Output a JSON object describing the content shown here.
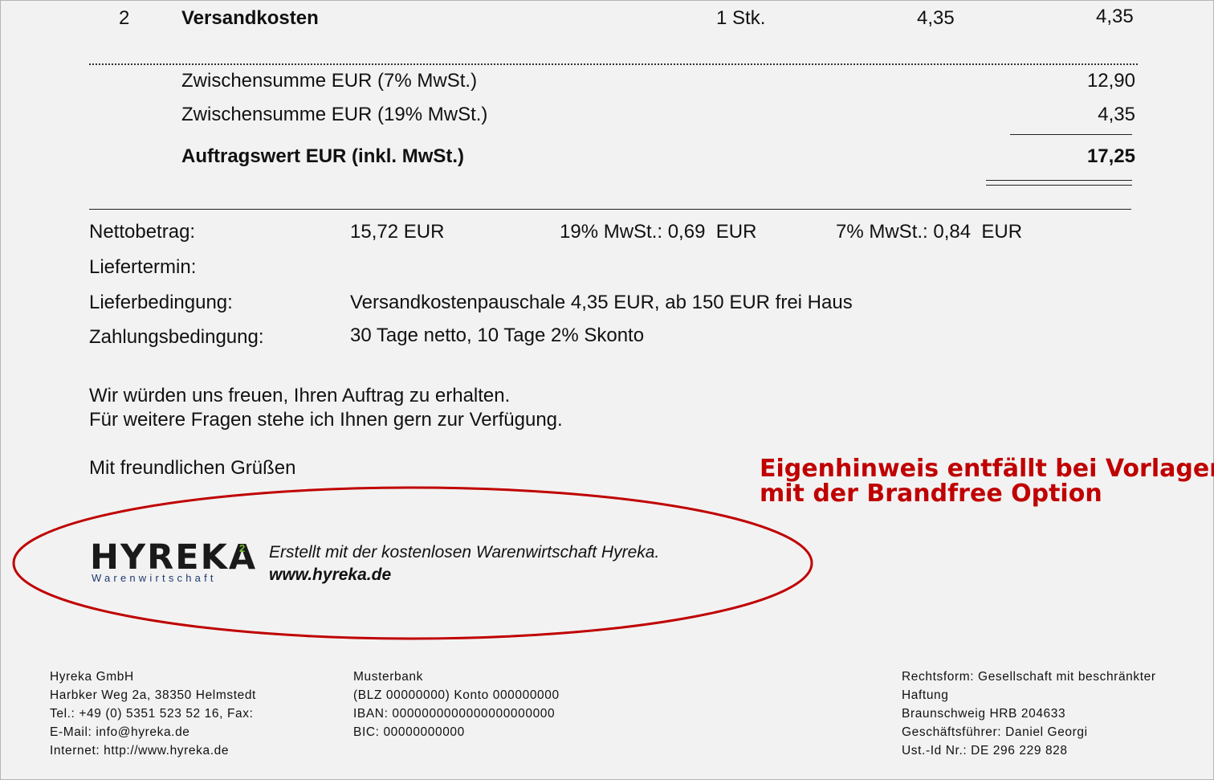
{
  "item": {
    "position": "2",
    "name": "Versandkosten",
    "quantity": "1 Stk.",
    "unit_price": "4,35",
    "total": "4,35"
  },
  "subtotals": {
    "sub7_label": "Zwischensumme EUR (7% MwSt.)",
    "sub7_value": "12,90",
    "sub19_label": "Zwischensumme EUR (19% MwSt.)",
    "sub19_value": "4,35",
    "order_label": "Auftragswert EUR (inkl. MwSt.)",
    "order_value": "17,25"
  },
  "summary": {
    "net_label": "Nettobetrag:",
    "net_value": "15,72 EUR",
    "vat19": "19% MwSt.: 0,69  EUR",
    "vat7": "7% MwSt.: 0,84  EUR",
    "delivery_date_label": "Liefertermin:",
    "delivery_terms_label": "Lieferbedingung:",
    "delivery_terms_value": "Versandkostenpauschale 4,35 EUR, ab 150 EUR frei Haus",
    "payment_terms_label": "Zahlungsbedingung:",
    "payment_terms_value": "30 Tage netto, 10 Tage 2% Skonto"
  },
  "closing": {
    "line1": "Wir würden uns freuen, Ihren Auftrag zu erhalten.",
    "line2": "Für weitere Fragen stehe ich Ihnen gern zur Verfügung.",
    "greeting": "Mit freundlichen Grüßen"
  },
  "promo": {
    "line1": "Eigenhinweis entfällt bei Vorlagen",
    "line2": "mit der Brandfree Option",
    "color": "#c00000"
  },
  "branding": {
    "logo_word": "HYREKA",
    "logo_superscript": "2",
    "logo_subtitle": "Warenwirtschaft",
    "text": "Erstellt mit der kostenlosen Warenwirtschaft Hyreka.",
    "url": "www.hyreka.de"
  },
  "footer": {
    "company": [
      "Hyreka GmbH",
      "Harbker Weg 2a, 38350 Helmstedt",
      "Tel.: +49 (0) 5351 523 52 16, Fax:",
      "E-Mail: info@hyreka.de",
      "Internet: http://www.hyreka.de"
    ],
    "bank": [
      "Musterbank",
      "(BLZ 00000000) Konto 000000000",
      "IBAN: 0000000000000000000000",
      "BIC: 00000000000"
    ],
    "legal": [
      "Rechtsform: Gesellschaft mit beschränkter",
      "Haftung",
      "Braunschweig HRB 204633",
      "Geschäftsführer: Daniel Georgi",
      "Ust.-Id Nr.: DE 296 229 828"
    ]
  }
}
